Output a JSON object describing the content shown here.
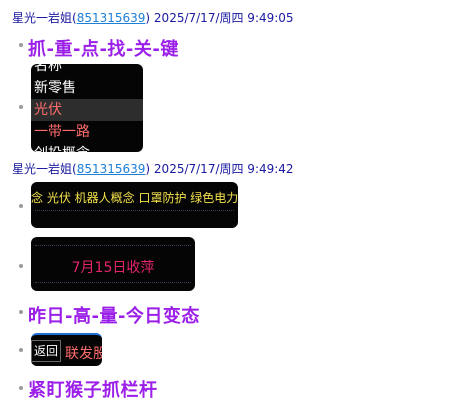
{
  "messages": [
    {
      "sender": "星光一岩姐(",
      "qq": "851315639",
      "close_paren": ")",
      "timestamp": "2025/7/17/周四 9:49:05"
    },
    {
      "sender": "星光一岩姐(",
      "qq": "851315639",
      "close_paren": ")",
      "timestamp": "2025/7/17/周四 9:49:42"
    }
  ],
  "headings": {
    "first": "抓-重-点-找-关-键",
    "second": "昨日-高-量-今日变态",
    "third": "紧盯猴子抓栏杆"
  },
  "concept_list": {
    "items": [
      "名称",
      "新零售",
      "光伏",
      "一带一路",
      "创投概念"
    ],
    "selected_index": 2
  },
  "ticker": {
    "text": "念 光伏 机器人概念 口罩防护 绿色电力"
  },
  "date_card": {
    "text": "7月15日收萍"
  },
  "small_card": {
    "back_label": "返回",
    "sub_text": "联发股"
  },
  "colors": {
    "heading": "#9b1fe8",
    "card_bg": "#050505",
    "ticker_text": "#f2e14a",
    "date_text": "#e2246d",
    "highlight_text": "#ff6c6c",
    "link": "#1e7fd6"
  }
}
